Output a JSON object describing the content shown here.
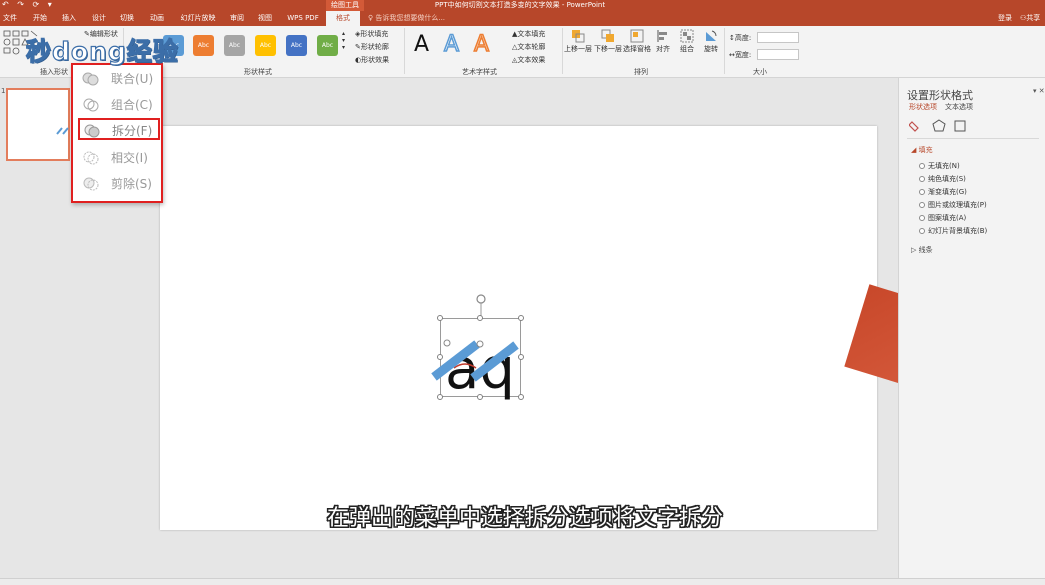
{
  "titlebar": {
    "quick_access": "↶ ↷ ⟳ ▾",
    "drawing_tools": "绘图工具",
    "title": "PPT中如何切割文本打造多变的文字效果 - PowerPoint"
  },
  "tabs": [
    {
      "label": "文件"
    },
    {
      "label": "开始"
    },
    {
      "label": "插入"
    },
    {
      "label": "设计"
    },
    {
      "label": "切换"
    },
    {
      "label": "动画"
    },
    {
      "label": "幻灯片放映"
    },
    {
      "label": "审阅"
    },
    {
      "label": "视图"
    },
    {
      "label": "WPS PDF"
    },
    {
      "label": "格式"
    }
  ],
  "tellme": "告诉我您想要做什么...",
  "account": {
    "login": "登录",
    "share": "共享"
  },
  "ribbon": {
    "insert_shapes_label": "插入形状",
    "shape_styles_label": "形状样式",
    "wordart_label": "艺术字样式",
    "arrange_label": "排列",
    "size_label": "大小",
    "edit_shape": "编辑形状",
    "swatch_text": "Abc",
    "shape_fill": "形状填充",
    "shape_outline": "形状轮廓",
    "shape_effects": "形状效果",
    "text_fill": "文本填充",
    "text_outline": "文本轮廓",
    "text_effects": "文本效果",
    "wordart_glyph": "A",
    "bring_forward": "上移一层",
    "send_backward": "下移一层",
    "selection_pane": "选择窗格",
    "align": "对齐",
    "group": "组合",
    "rotate": "旋转",
    "height": "高度:",
    "width": "宽度:"
  },
  "swatch_colors": [
    "#5b9bd5",
    "#ed7d31",
    "#a5a5a5",
    "#ffc000",
    "#4472c4",
    "#70ad47"
  ],
  "wordart_colors": [
    "#111111",
    "#5b9bd5",
    "#ed7d31"
  ],
  "merge_menu": {
    "items": [
      {
        "label": "联合(U)",
        "icon": "union-icon"
      },
      {
        "label": "组合(C)",
        "icon": "combine-icon"
      },
      {
        "label": "拆分(F)",
        "icon": "fragment-icon",
        "highlighted": true
      },
      {
        "label": "相交(I)",
        "icon": "intersect-icon"
      },
      {
        "label": "剪除(S)",
        "icon": "subtract-icon"
      }
    ]
  },
  "thumbnail": {
    "number": "1"
  },
  "right_pane": {
    "title": "设置形状格式",
    "close": "▾ ✕",
    "tab_shape": "形状选项",
    "tab_text": "文本选项",
    "fill_header": "◢ 填充",
    "fill_options": [
      "无填充(N)",
      "纯色填充(S)",
      "渐变填充(G)",
      "图片或纹理填充(P)",
      "图案填充(A)",
      "幻灯片背景填充(B)"
    ],
    "line_header": "▷ 线条"
  },
  "slide": {
    "text_shape": "aq"
  },
  "watermark": "秒dong经验",
  "subtitle": "在弹出的菜单中选择拆分选项将文字拆分",
  "colors": {
    "accent": "#b7472a",
    "highlight_red": "#e02020",
    "stripe_blue": "#5b9bd5",
    "square_red": "#cd5033"
  }
}
